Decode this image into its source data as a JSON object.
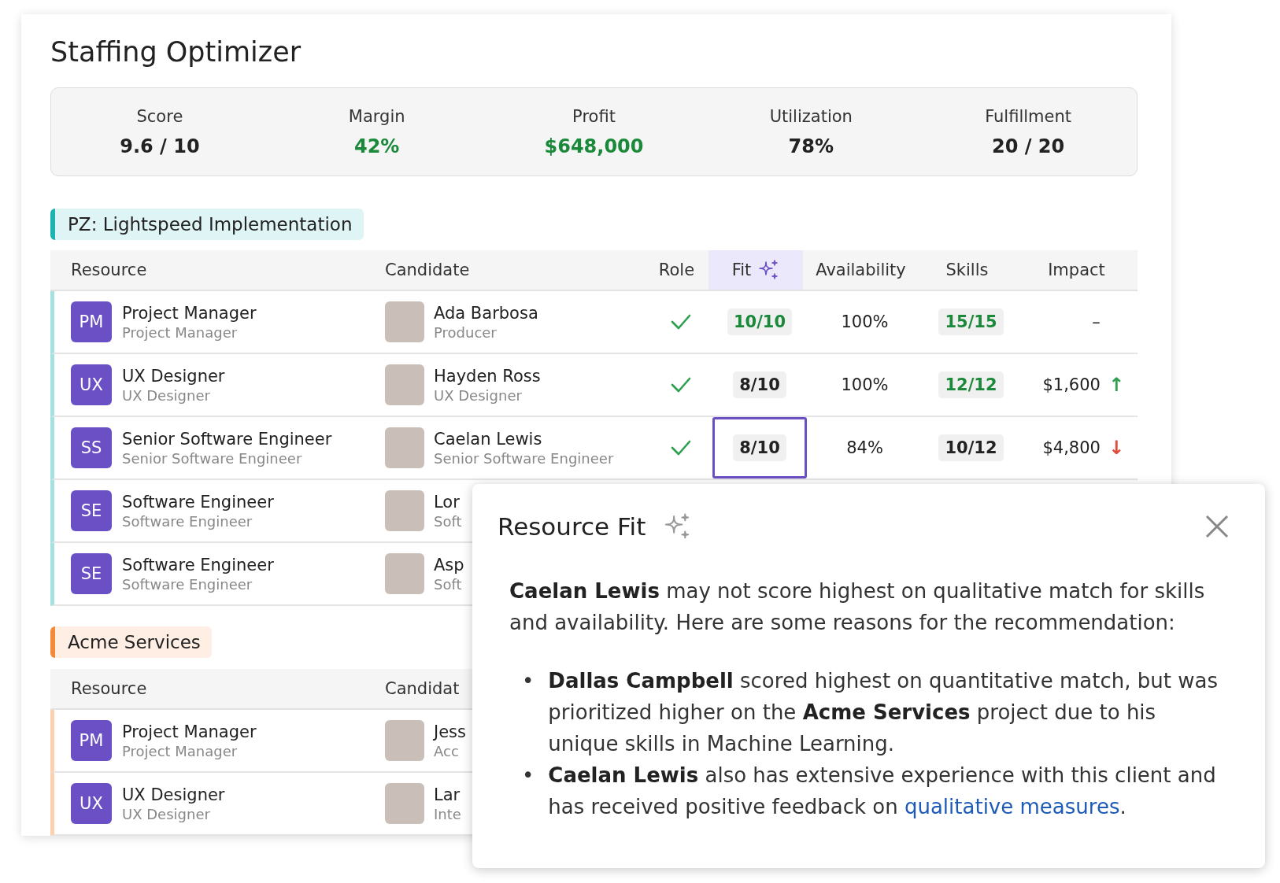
{
  "title": "Staffing Optimizer",
  "metrics": [
    {
      "label": "Score",
      "value": "9.6 / 10",
      "positive": false
    },
    {
      "label": "Margin",
      "value": "42%",
      "positive": true
    },
    {
      "label": "Profit",
      "value": "$648,000",
      "positive": true
    },
    {
      "label": "Utilization",
      "value": "78%",
      "positive": false
    },
    {
      "label": "Fulfillment",
      "value": "20 / 20",
      "positive": false
    }
  ],
  "projects": [
    {
      "name": "PZ: Lightspeed Implementation",
      "color": "#1db3b0",
      "columns": [
        {
          "label": "Resource",
          "selected": false
        },
        {
          "label": "Candidate",
          "selected": false
        },
        {
          "label": "Role",
          "selected": false
        },
        {
          "label": "Fit",
          "selected": true
        },
        {
          "label": "Availability",
          "selected": false
        },
        {
          "label": "Skills",
          "selected": false
        },
        {
          "label": "Impact",
          "selected": false
        }
      ],
      "rows": [
        {
          "initials": "PM",
          "resource": "Project Manager",
          "resource_sub": "Project Manager",
          "candidate": "Ada Barbosa",
          "candidate_sub": "Producer",
          "role_match": true,
          "fit": {
            "text": "10/10",
            "best": true,
            "selected": false
          },
          "availability": "100%",
          "skills": {
            "text": "15/15",
            "best": true
          },
          "impact": {
            "text": "–"
          }
        },
        {
          "initials": "UX",
          "resource": "UX Designer",
          "resource_sub": "UX Designer",
          "candidate": "Hayden Ross",
          "candidate_sub": "UX Designer",
          "role_match": true,
          "fit": {
            "text": "8/10",
            "best": false,
            "selected": false
          },
          "availability": "100%",
          "skills": {
            "text": "12/12",
            "best": true
          },
          "impact": {
            "text": "$1,600",
            "arrow": "↑",
            "kind": "up"
          }
        },
        {
          "initials": "SS",
          "resource": "Senior Software Engineer",
          "resource_sub": "Senior Software Engineer",
          "candidate": "Caelan Lewis",
          "candidate_sub": "Senior Software Engineer",
          "role_match": true,
          "fit": {
            "text": "8/10",
            "best": false,
            "selected": true
          },
          "availability": "84%",
          "skills": {
            "text": "10/12",
            "best": false
          },
          "impact": {
            "text": "$4,800",
            "arrow": "↓",
            "kind": "down"
          }
        },
        {
          "initials": "SE",
          "resource": "Software Engineer",
          "resource_sub": "Software Engineer",
          "candidate": "Lor",
          "candidate_sub": "Soft"
        },
        {
          "initials": "SE",
          "resource": "Software Engineer",
          "resource_sub": "Software Engineer",
          "candidate": "Asp",
          "candidate_sub": "Soft"
        }
      ]
    },
    {
      "name": "Acme Services",
      "color": "#f5893a",
      "columns": [
        {
          "label": "Resource",
          "selected": false
        },
        {
          "label": "Candidat",
          "selected": false
        }
      ],
      "rows": [
        {
          "initials": "PM",
          "resource": "Project Manager",
          "resource_sub": "Project Manager",
          "candidate": "Jess",
          "candidate_sub": "Acc"
        },
        {
          "initials": "UX",
          "resource": "UX Designer",
          "resource_sub": "UX Designer",
          "candidate": "Lar",
          "candidate_sub": "Inte"
        }
      ]
    }
  ],
  "popup": {
    "title": "Resource Fit",
    "intro": "**Caelan Lewis** may not score highest on qualitative match for skills and availability. Here are some reasons for the recommendation:",
    "bullets": [
      {
        "marker": "•",
        "text": "**Dallas Campbell** scored highest on quantitative match, but was prioritized higher on the **Acme Services** project due to his unique skills in Machine Learning."
      },
      {
        "marker": "•",
        "text": "**Caelan Lewis** also has extensive experience with this client and has received positive feedback on ",
        "link": "qualitative measures",
        "after": "."
      }
    ]
  }
}
